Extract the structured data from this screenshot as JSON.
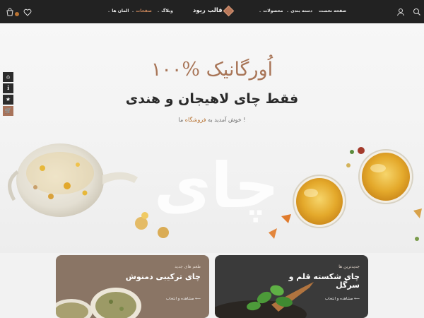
{
  "header": {
    "logo_text": "قالب ریود",
    "nav": [
      {
        "label": "صفحه نخست"
      },
      {
        "label": "دسته بندی"
      },
      {
        "label": "محصولات"
      },
      {
        "label": "وبلاگ"
      },
      {
        "label": "صفحات"
      },
      {
        "label": "المان ها"
      }
    ],
    "icons": [
      "search-icon",
      "user-icon",
      "heart-icon",
      "cart-icon"
    ],
    "cart_badge": "0"
  },
  "hero": {
    "title": "۱۰۰% اُورگانیک",
    "subtitle": "فقط چای لاهیجان و هندی",
    "welcome_prefix": "خوش آمدید به ",
    "welcome_highlight": "فروشگاه",
    "welcome_suffix": " ما !",
    "watermark": "چای"
  },
  "side_tools": [
    "home-icon",
    "info-icon",
    "star-icon",
    "cart-icon"
  ],
  "cards": [
    {
      "kicker": "طعم های جدید",
      "title": "چای ترکیبی دمنوش",
      "cta": "مشاهده و انتخاب"
    },
    {
      "kicker": "جدیدترین ها",
      "title": "چای شکسته قلم و سرگل",
      "cta": "مشاهده و انتخاب"
    }
  ],
  "colors": {
    "accent": "#b87333",
    "header_bg": "#222222",
    "title": "#a87557"
  }
}
